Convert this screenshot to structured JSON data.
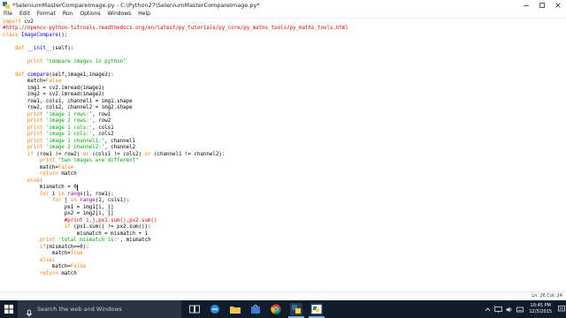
{
  "window": {
    "title": "*SeleniumMasterCompareImage.py - C:\\Python27\\SeleniumMasterCompareImage.py*"
  },
  "menu": [
    "File",
    "Edit",
    "Format",
    "Run",
    "Options",
    "Windows",
    "Help"
  ],
  "code_lines": [
    [
      [
        "kw",
        "import"
      ],
      [
        "pl",
        " cv2"
      ]
    ],
    [
      [
        "cm",
        "#http://opencv-python-tutroals.readthedocs.org/en/latest/py_tutorials/py_core/py_maths_tools/py_maths_tools.html"
      ]
    ],
    [
      [
        "kw",
        "class"
      ],
      [
        "pl",
        " "
      ],
      [
        "df",
        "ImageCompare"
      ],
      [
        "pl",
        "():"
      ]
    ],
    [],
    [
      [
        "pl",
        "    "
      ],
      [
        "kw",
        "def"
      ],
      [
        "pl",
        " "
      ],
      [
        "df",
        "__init__"
      ],
      [
        "pl",
        "(self):"
      ]
    ],
    [],
    [
      [
        "pl",
        "        "
      ],
      [
        "kw",
        "print"
      ],
      [
        "pl",
        " "
      ],
      [
        "str",
        "\"compare images in python\""
      ]
    ],
    [],
    [
      [
        "pl",
        "    "
      ],
      [
        "kw",
        "def"
      ],
      [
        "pl",
        " "
      ],
      [
        "df",
        "compare"
      ],
      [
        "pl",
        "(self,image1,image2):"
      ]
    ],
    [
      [
        "pl",
        "        match="
      ],
      [
        "kw",
        "False"
      ]
    ],
    [
      [
        "pl",
        "        img1 = cv2.imread(image1)"
      ]
    ],
    [
      [
        "pl",
        "        img2 = cv2.imread(image2)"
      ]
    ],
    [
      [
        "pl",
        "        row1, cols1, channel1 = img1.shape"
      ]
    ],
    [
      [
        "pl",
        "        row2, cols2, channel2 = img2.shape"
      ]
    ],
    [
      [
        "pl",
        "        "
      ],
      [
        "kw",
        "print"
      ],
      [
        "pl",
        " "
      ],
      [
        "str",
        "'image 1 rows:'"
      ],
      [
        "pl",
        ", row1"
      ]
    ],
    [
      [
        "pl",
        "        "
      ],
      [
        "kw",
        "print"
      ],
      [
        "pl",
        " "
      ],
      [
        "str",
        "'image 2 rows:'"
      ],
      [
        "pl",
        ", row2"
      ]
    ],
    [
      [
        "pl",
        "        "
      ],
      [
        "kw",
        "print"
      ],
      [
        "pl",
        " "
      ],
      [
        "str",
        "'image 1 cols:'"
      ],
      [
        "pl",
        ", cols1"
      ]
    ],
    [
      [
        "pl",
        "        "
      ],
      [
        "kw",
        "print"
      ],
      [
        "pl",
        " "
      ],
      [
        "str",
        "'image 2 cols:'"
      ],
      [
        "pl",
        ", cols2"
      ]
    ],
    [
      [
        "pl",
        "        "
      ],
      [
        "kw",
        "print"
      ],
      [
        "pl",
        " "
      ],
      [
        "str",
        "'image 1 channel1:'"
      ],
      [
        "pl",
        ", channel1"
      ]
    ],
    [
      [
        "pl",
        "        "
      ],
      [
        "kw",
        "print"
      ],
      [
        "pl",
        " "
      ],
      [
        "str",
        "'image 2 channel2:'"
      ],
      [
        "pl",
        ", channel2"
      ]
    ],
    [
      [
        "pl",
        "        "
      ],
      [
        "kw",
        "if"
      ],
      [
        "pl",
        " (row1 != row2) "
      ],
      [
        "kw",
        "or"
      ],
      [
        "pl",
        " (cols1 != cols2) "
      ],
      [
        "kw",
        "or"
      ],
      [
        "pl",
        " (channel1 != channel2):"
      ]
    ],
    [
      [
        "pl",
        "            "
      ],
      [
        "kw",
        "print"
      ],
      [
        "pl",
        " "
      ],
      [
        "str",
        "\"two images are different\""
      ]
    ],
    [
      [
        "pl",
        "            match="
      ],
      [
        "kw",
        "False"
      ]
    ],
    [
      [
        "pl",
        "            "
      ],
      [
        "kw",
        "return"
      ],
      [
        "pl",
        " match"
      ]
    ],
    [
      [
        "pl",
        "        "
      ],
      [
        "kw",
        "else"
      ],
      [
        "pl",
        ":"
      ]
    ],
    [
      [
        "pl",
        "            mismatch = 0"
      ],
      [
        "caret",
        ""
      ]
    ],
    [
      [
        "pl",
        "            "
      ],
      [
        "kw",
        "for"
      ],
      [
        "pl",
        " i "
      ],
      [
        "kw",
        "in"
      ],
      [
        "pl",
        " "
      ],
      [
        "bi",
        "range"
      ],
      [
        "pl",
        "(1, row1):"
      ]
    ],
    [
      [
        "pl",
        "                "
      ],
      [
        "kw",
        "for"
      ],
      [
        "pl",
        " j "
      ],
      [
        "kw",
        "in"
      ],
      [
        "pl",
        " "
      ],
      [
        "bi",
        "range"
      ],
      [
        "pl",
        "(1, cols1):"
      ]
    ],
    [
      [
        "pl",
        "                    px1 = img1[i, j]"
      ]
    ],
    [
      [
        "pl",
        "                    px2 = img2[i, j]"
      ]
    ],
    [
      [
        "cm",
        "                    #print i,j,px1.sum(),px2.sum()"
      ]
    ],
    [
      [
        "pl",
        "                    "
      ],
      [
        "kw",
        "if"
      ],
      [
        "pl",
        " (px1.sum() != px2.sum()):"
      ]
    ],
    [
      [
        "pl",
        "                        mismatch = mismatch + 1"
      ]
    ],
    [
      [
        "pl",
        "            "
      ],
      [
        "kw",
        "print"
      ],
      [
        "pl",
        " "
      ],
      [
        "str",
        "'total mismatch is:'"
      ],
      [
        "pl",
        ", mismatch"
      ]
    ],
    [
      [
        "pl",
        "            "
      ],
      [
        "kw",
        "if"
      ],
      [
        "pl",
        "(mismatch==0):"
      ]
    ],
    [
      [
        "pl",
        "                match="
      ],
      [
        "kw",
        "True"
      ]
    ],
    [
      [
        "pl",
        "            "
      ],
      [
        "kw",
        "else"
      ],
      [
        "pl",
        ":"
      ]
    ],
    [
      [
        "pl",
        "                match="
      ],
      [
        "kw",
        "False"
      ]
    ],
    [
      [
        "pl",
        "            "
      ],
      [
        "kw",
        "return"
      ],
      [
        "pl",
        " match"
      ]
    ]
  ],
  "status": {
    "position": "Ln: 26 Col: 24"
  },
  "taskbar": {
    "search_placeholder": "Search the web and Windows",
    "clock_time": "10:45 PM",
    "clock_date": "12/3/2015"
  },
  "colors": {
    "keyword": "#ff7700",
    "builtin": "#900090",
    "string": "#00aa00",
    "comment": "#dd0000",
    "definition": "#0000ff",
    "taskbar_bg": "#101b2c"
  }
}
